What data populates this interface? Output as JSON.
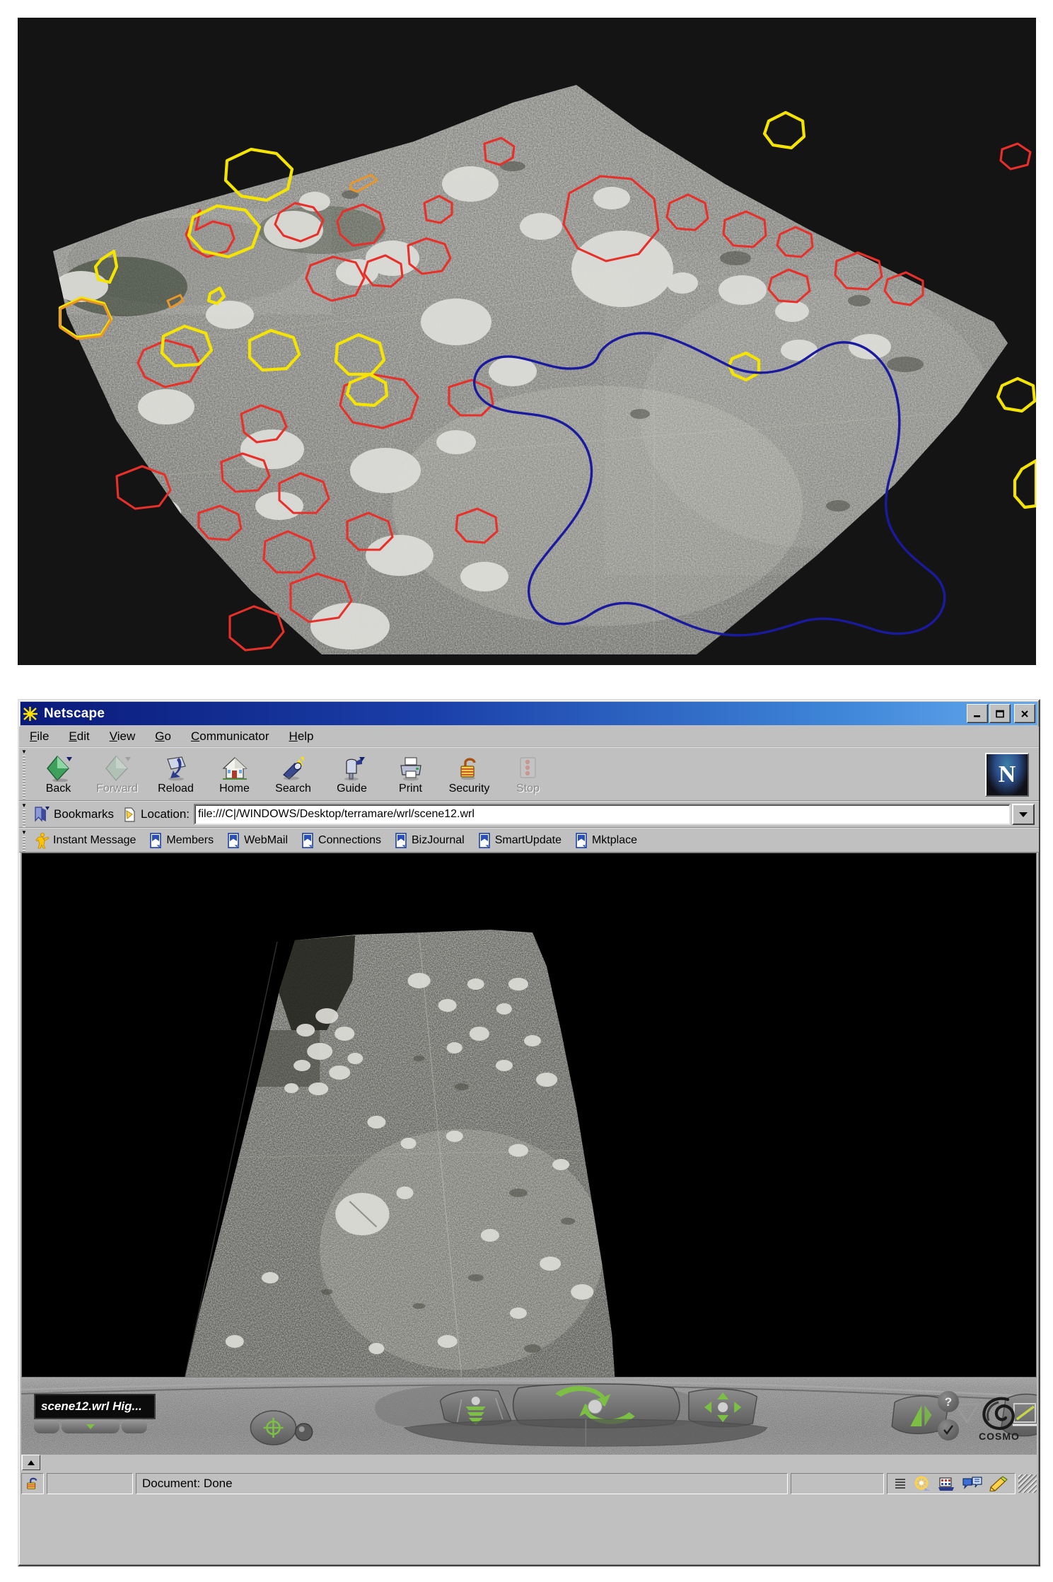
{
  "top_figure": {
    "caption_present": false,
    "background_color": "#141414",
    "annotation_colors": {
      "stones_red": "#e8302a",
      "stones_yellow": "#f5e400",
      "area_blue": "#1a1a9e",
      "orange": "#e8962a"
    },
    "description": "3D photo-textured terrain model of an archaeological excavation surface with outlined stone features and a large blue outlined area"
  },
  "window": {
    "title": "Netscape",
    "app_icon": "netscape-ship-wheel-icon",
    "controls": {
      "minimize": "_",
      "maximize": "□",
      "close": "✕"
    }
  },
  "menubar": {
    "items": [
      {
        "name": "file",
        "pre": "",
        "accel": "F",
        "post": "ile"
      },
      {
        "name": "edit",
        "pre": "",
        "accel": "E",
        "post": "dit"
      },
      {
        "name": "view",
        "pre": "",
        "accel": "V",
        "post": "iew"
      },
      {
        "name": "go",
        "pre": "",
        "accel": "G",
        "post": "o"
      },
      {
        "name": "communicator",
        "pre": "",
        "accel": "C",
        "post": "ommunicator"
      },
      {
        "name": "help",
        "pre": "",
        "accel": "H",
        "post": "elp"
      }
    ]
  },
  "toolbar": {
    "buttons": [
      {
        "label": "Back",
        "icon": "back-arrow-icon",
        "disabled": false
      },
      {
        "label": "Forward",
        "icon": "forward-arrow-icon",
        "disabled": true
      },
      {
        "label": "Reload",
        "icon": "reload-icon",
        "disabled": false
      },
      {
        "label": "Home",
        "icon": "home-icon",
        "disabled": false
      },
      {
        "label": "Search",
        "icon": "search-flashlight-icon",
        "disabled": false
      },
      {
        "label": "Guide",
        "icon": "guide-mailbox-icon",
        "disabled": false
      },
      {
        "label": "Print",
        "icon": "printer-icon",
        "disabled": false
      },
      {
        "label": "Security",
        "icon": "security-lock-icon",
        "disabled": false
      },
      {
        "label": "Stop",
        "icon": "stop-icon",
        "disabled": true
      }
    ],
    "logo_letter": "N"
  },
  "location_bar": {
    "bookmarks_label": "Bookmarks",
    "bookmarks_icon": "bookmark-icon",
    "location_label": "Location:",
    "location_icon": "page-icon",
    "url": "file:///C|/WINDOWS/Desktop/terramare/wrl/scene12.wrl",
    "dropdown_icon": "chevron-down-icon"
  },
  "personal_toolbar": {
    "items": [
      {
        "label": "Instant Message",
        "icon": "instant-message-icon"
      },
      {
        "label": "Members",
        "icon": "bookmark-page-icon"
      },
      {
        "label": "WebMail",
        "icon": "bookmark-page-icon"
      },
      {
        "label": "Connections",
        "icon": "bookmark-page-icon"
      },
      {
        "label": "BizJournal",
        "icon": "bookmark-page-icon"
      },
      {
        "label": "SmartUpdate",
        "icon": "bookmark-page-icon"
      },
      {
        "label": "Mktplace",
        "icon": "bookmark-page-icon"
      }
    ]
  },
  "vrml_viewport": {
    "background_color": "#000000",
    "description": "VRML scene showing the photo-textured terrain mesh viewed from above at an oblique angle"
  },
  "cosmo_player": {
    "viewpoint_name": "scene12.wrl Hig...",
    "controls": [
      {
        "name": "seek-button",
        "icon": "crosshair-target-icon"
      },
      {
        "name": "pan-up-down-button",
        "icon": "pan-vertical-icon"
      },
      {
        "name": "rotate-button",
        "icon": "rotate-arrows-icon"
      },
      {
        "name": "pan-button",
        "icon": "four-way-arrows-icon"
      },
      {
        "name": "go-to-button",
        "icon": "green-triangle-icon"
      },
      {
        "name": "straighten-up-button",
        "icon": "level-view-icon"
      },
      {
        "name": "help-button",
        "icon": "question-mark-icon"
      },
      {
        "name": "preferences-button",
        "icon": "checkmark-icon"
      }
    ],
    "brand": "COSMO",
    "brand_icon": "cosmo-spiral-logo"
  },
  "statusbar": {
    "lock_icon": "security-unlocked-icon",
    "message": "Document: Done",
    "component_icons": [
      {
        "name": "task-list-icon"
      },
      {
        "name": "navigator-icon"
      },
      {
        "name": "mailbox-icon"
      },
      {
        "name": "discussions-icon"
      },
      {
        "name": "composer-icon"
      }
    ],
    "resize_grip": "resize-grip-icon"
  }
}
